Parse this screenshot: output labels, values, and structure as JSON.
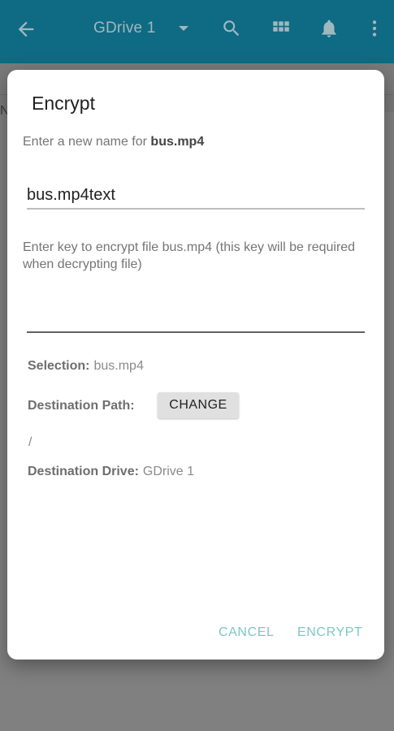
{
  "appbar": {
    "title": "GDrive 1",
    "icons": [
      "back-arrow-icon",
      "dropdown-icon",
      "search-icon",
      "grid-icon",
      "bell-icon",
      "more-vert-icon"
    ],
    "color": "#0f6a83"
  },
  "background": {
    "peek_text": "N"
  },
  "dialog": {
    "title": "Encrypt",
    "name_prompt": "Enter a new name for ",
    "file_name": "bus.mp4",
    "name_value": "bus.mp4text",
    "key_prompt": "Enter key to encrypt file bus.mp4 (this key will be required when decrypting file)",
    "key_value": "",
    "selection_label": "Selection:",
    "selection_value": "bus.mp4",
    "destination_path_label": "Destination Path:",
    "change_button": "CHANGE",
    "destination_path_value": "/",
    "destination_drive_label": "Destination Drive:",
    "destination_drive_value": "GDrive 1",
    "cancel_button": "CANCEL",
    "encrypt_button": "ENCRYPT",
    "accent_color": "#7ac9c4"
  }
}
